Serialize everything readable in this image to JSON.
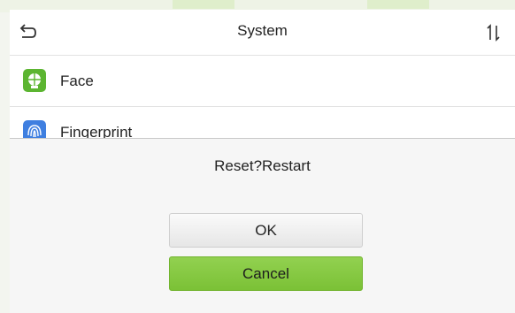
{
  "header": {
    "title": "System",
    "back_icon": "back-arrow-icon",
    "sort_icon": "sort-icon"
  },
  "menu": {
    "items": [
      {
        "label": "Face",
        "icon": "face-icon",
        "color": "#5cb531"
      },
      {
        "label": "Fingerprint",
        "icon": "fingerprint-icon",
        "color": "#3f7fe0"
      }
    ]
  },
  "dialog": {
    "title": "Reset?Restart",
    "ok_label": "OK",
    "cancel_label": "Cancel"
  },
  "colors": {
    "accent_green": "#84c63e",
    "dialog_background": "#f6f6f6"
  }
}
